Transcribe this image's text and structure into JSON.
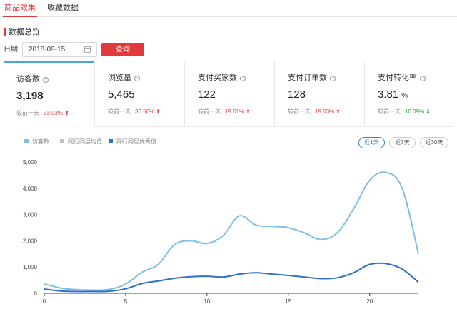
{
  "tabs": [
    {
      "label": "商品效果",
      "active": true
    },
    {
      "label": "收藏数据",
      "active": false
    }
  ],
  "section_title": "数据总览",
  "date_filter": {
    "label": "日期:",
    "value": "2018-09-15",
    "query_label": "查询"
  },
  "metrics": [
    {
      "title": "访客数",
      "value": "3,198",
      "unit": "",
      "compare_label": "较前一天",
      "change": "33.03%",
      "direction": "up",
      "active": true
    },
    {
      "title": "浏览量",
      "value": "5,465",
      "unit": "",
      "compare_label": "较前一天",
      "change": "36.56%",
      "direction": "up",
      "active": false
    },
    {
      "title": "支付买家数",
      "value": "122",
      "unit": "",
      "compare_label": "较前一天",
      "change": "19.61%",
      "direction": "up",
      "active": false
    },
    {
      "title": "支付订单数",
      "value": "128",
      "unit": "",
      "compare_label": "较前一天",
      "change": "19.63%",
      "direction": "up",
      "active": false
    },
    {
      "title": "支付转化率",
      "value": "3.81",
      "unit": "%",
      "compare_label": "较前一天",
      "change": "10.09%",
      "direction": "down",
      "active": false
    }
  ],
  "colors": {
    "accent_red": "#e4393c",
    "up": "#e4393c",
    "down": "#2e9a3b",
    "series_visitors": "#7dbfe6",
    "series_avg": "#bfbfbf",
    "series_excellent": "#2f6fcc"
  },
  "range_buttons": [
    {
      "label": "近1天",
      "active": true
    },
    {
      "label": "近7天",
      "active": false
    },
    {
      "label": "近30天",
      "active": false
    }
  ],
  "chart_data": {
    "type": "line",
    "title": "",
    "xlabel": "",
    "ylabel": "",
    "grid": false,
    "legend": "top-left",
    "xlim": [
      0,
      23
    ],
    "ylim": [
      0,
      5000
    ],
    "x_ticks": [
      0,
      5,
      10,
      15,
      20
    ],
    "y_ticks": [
      0,
      1000,
      2000,
      3000,
      4000,
      5000
    ],
    "y_tick_labels": [
      "0",
      "1,000",
      "2,000",
      "3,000",
      "4,000",
      "5,000"
    ],
    "x": [
      0,
      1,
      2,
      3,
      4,
      5,
      6,
      7,
      8,
      9,
      10,
      11,
      12,
      13,
      14,
      15,
      16,
      17,
      18,
      19,
      20,
      21,
      22,
      23
    ],
    "series": [
      {
        "name": "访客数",
        "color": "#7dbfe6",
        "values": [
          360,
          200,
          140,
          120,
          150,
          350,
          800,
          1100,
          1850,
          2000,
          1900,
          2200,
          2950,
          2600,
          2550,
          2500,
          2300,
          2050,
          2300,
          3200,
          4300,
          4600,
          4000,
          1500
        ]
      },
      {
        "name": "同行同层均值",
        "color": "#bfbfbf",
        "values": []
      },
      {
        "name": "同行同层优秀值",
        "color": "#2f6fcc",
        "values": [
          160,
          90,
          70,
          70,
          80,
          170,
          370,
          470,
          570,
          630,
          650,
          620,
          730,
          780,
          730,
          680,
          620,
          560,
          590,
          780,
          1100,
          1130,
          920,
          420
        ]
      }
    ]
  }
}
